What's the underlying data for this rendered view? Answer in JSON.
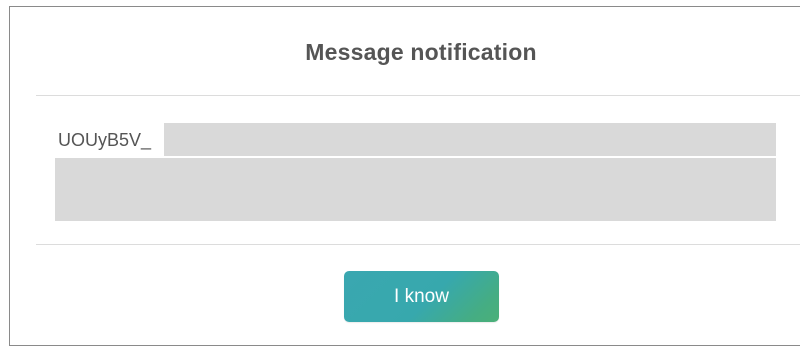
{
  "dialog": {
    "title": "Message notification",
    "message_visible_text": "UOUyB5V_",
    "button_label": "I know"
  },
  "colors": {
    "title_text": "#555555",
    "divider": "#dcdcdc",
    "redaction": "#d9d9d9",
    "button_gradient_start": "#3aa7b0",
    "button_gradient_end": "#4bb078",
    "button_text": "#ffffff"
  }
}
